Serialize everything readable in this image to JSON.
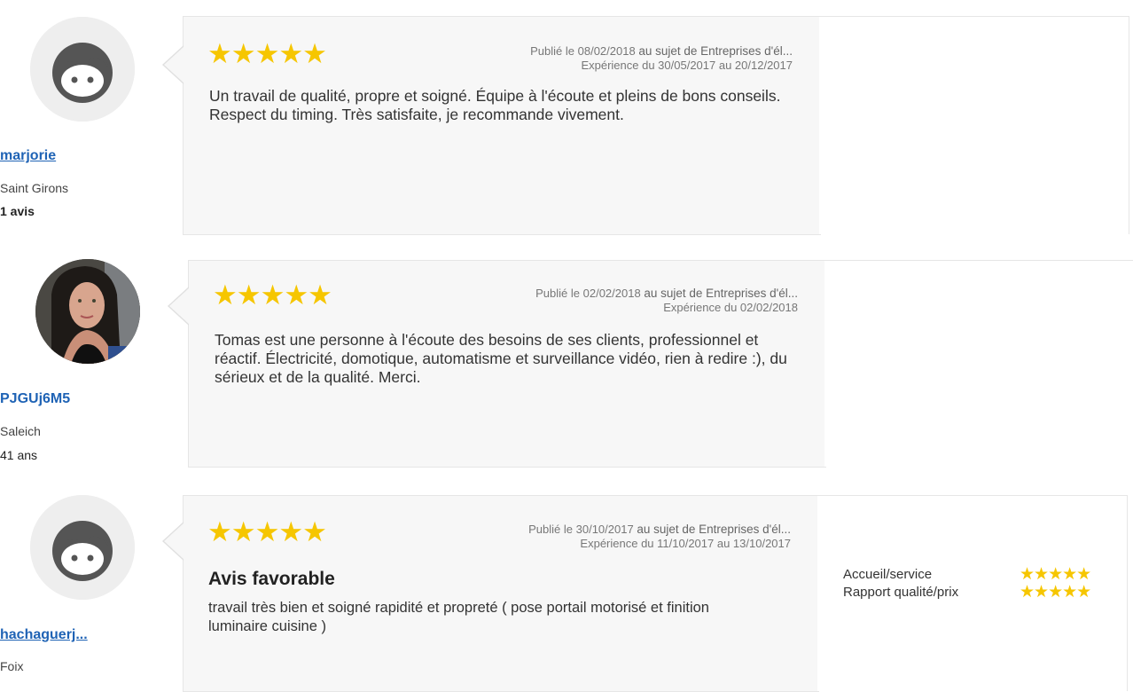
{
  "reviews": [
    {
      "user": {
        "name": "marjorie",
        "city": "Saint Girons",
        "extra": "1 avis",
        "avatar": "default-face-icon"
      },
      "rating": 5,
      "stars": "★★★★★",
      "published": "Publié le 08/02/2018",
      "subject": "au sujet de Entreprises d'él...",
      "experience": "Expérience du 30/05/2017 au 20/12/2017",
      "text": "Un travail de qualité, propre et soigné. Équipe à l'écoute et pleins de bons conseils. Respect du timing. Très satisfaite, je recommande vivement."
    },
    {
      "user": {
        "name": "PJGUj6M5",
        "city": "Saleich",
        "extra": "41 ans",
        "avatar": "user-photo"
      },
      "rating": 5,
      "stars": "★★★★★",
      "published": "Publié le 02/02/2018",
      "subject": "au sujet de Entreprises d'él...",
      "experience": "Expérience du 02/02/2018",
      "text": "Tomas est une personne à l'écoute des besoins de ses clients, professionnel et réactif. Électricité, domotique, automatisme et surveillance vidéo, rien à redire :), du sérieux et de la qualité. Merci."
    },
    {
      "user": {
        "name": "hachaguerj...",
        "city": "Foix",
        "avatar": "default-face-icon"
      },
      "rating": 5,
      "stars": "★★★★★",
      "published": "Publié le 30/10/2017",
      "subject": "au sujet de Entreprises d'él...",
      "experience": "Expérience du 11/10/2017 au 13/10/2017",
      "title": "Avis favorable",
      "text": "travail très bien et soigné rapidité et propreté ( pose portail motorisé et finition luminaire cuisine )",
      "criteria": [
        {
          "label": "Accueil/service",
          "rating": 5,
          "stars": "★★★★★"
        },
        {
          "label": "Rapport qualité/prix",
          "rating": 5,
          "stars": "★★★★★"
        }
      ]
    }
  ],
  "colors": {
    "accent": "#1f63b5",
    "star": "#f6c600",
    "card_bg": "#f7f7f7"
  }
}
